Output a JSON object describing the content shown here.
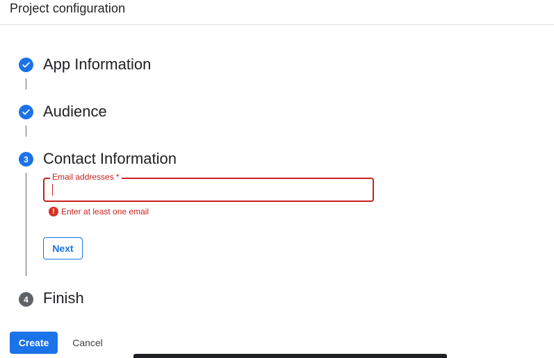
{
  "header": {
    "title": "Project configuration"
  },
  "steps": [
    {
      "label": "App Information",
      "state": "done",
      "icon": "check-icon"
    },
    {
      "label": "Audience",
      "state": "done",
      "icon": "check-icon"
    },
    {
      "label": "Contact Information",
      "state": "active",
      "number": "3"
    },
    {
      "label": "Finish",
      "state": "pending",
      "number": "4"
    }
  ],
  "contact_form": {
    "email_label": "Email addresses *",
    "email_value": "",
    "error_icon": "error-icon",
    "error_glyph": "!",
    "error_text": "Enter at least one email",
    "next_label": "Next"
  },
  "footer": {
    "create_label": "Create",
    "cancel_label": "Cancel"
  },
  "colors": {
    "primary": "#1a73e8",
    "error": "#c5221f",
    "pending": "#5f6368"
  }
}
